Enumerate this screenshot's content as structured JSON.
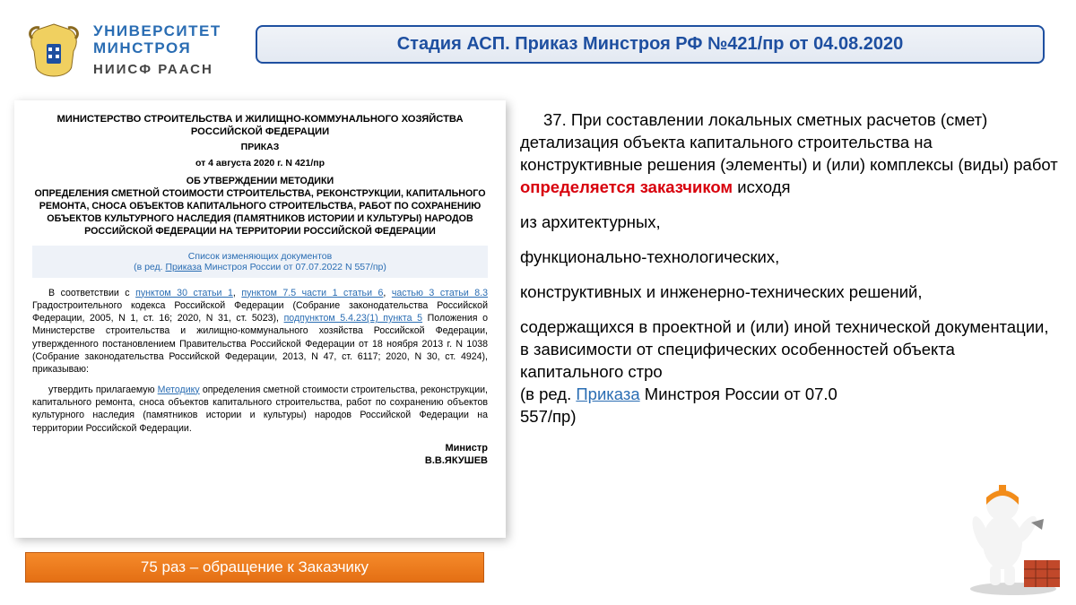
{
  "logo": {
    "uni1": "УНИВЕРСИТЕТ",
    "uni2": "МИНСТРОЯ",
    "sub": "НИИСФ РААСН"
  },
  "title": "Стадия АСП.  Приказ Минстроя РФ №421/пр от 04.08.2020",
  "doc": {
    "ministry": "МИНИСТЕРСТВО СТРОИТЕЛЬСТВА И ЖИЛИЩНО-КОММУНАЛЬНОГО ХОЗЯЙСТВА РОССИЙСКОЙ ФЕДЕРАЦИИ",
    "order": "ПРИКАЗ",
    "date": "от 4 августа 2020 г. N 421/пр",
    "about1": "ОБ УТВЕРЖДЕНИИ МЕТОДИКИ",
    "about2": "ОПРЕДЕЛЕНИЯ СМЕТНОЙ СТОИМОСТИ СТРОИТЕЛЬСТВА, РЕКОНСТРУКЦИИ, КАПИТАЛЬНОГО РЕМОНТА, СНОСА ОБЪЕКТОВ КАПИТАЛЬНОГО СТРОИТЕЛЬСТВА, РАБОТ ПО СОХРАНЕНИЮ ОБЪЕКТОВ КУЛЬТУРНОГО НАСЛЕДИЯ (ПАМЯТНИКОВ ИСТОРИИ И КУЛЬТУРЫ) НАРОДОВ РОССИЙСКОЙ ФЕДЕРАЦИИ НА ТЕРРИТОРИИ РОССИЙСКОЙ ФЕДЕРАЦИИ",
    "changes_caption": "Список изменяющих документов",
    "changes_line_pre": "(в ред. ",
    "changes_link": "Приказа",
    "changes_line_post": " Минстроя России от 07.07.2022 N 557/пр)",
    "p1_a": "В соответствии с ",
    "p1_l1": "пунктом 30 статьи 1",
    "p1_b": ", ",
    "p1_l2": "пунктом 7.5 части 1 статьи 6",
    "p1_c": ", ",
    "p1_l3": "частью 3 статьи 8.3",
    "p1_d": " Градостроительного кодекса Российской Федерации (Собрание законодательства Российской Федерации, 2005, N 1, ст. 16; 2020, N 31, ст. 5023), ",
    "p1_l4": "подпунктом 5.4.23(1) пункта 5",
    "p1_e": " Положения о Министерстве строительства и жилищно-коммунального хозяйства Российской Федерации, утвержденного постановлением Правительства Российской Федерации от 18 ноября 2013 г. N 1038 (Собрание законодательства Российской Федерации, 2013, N 47, ст. 6117; 2020, N 30, ст. 4924), приказываю:",
    "p2_a": "утвердить прилагаемую ",
    "p2_l": "Методику",
    "p2_b": " определения сметной стоимости строительства, реконструкции, капитального ремонта, сноса объектов капитального строительства, работ по сохранению объектов культурного наследия (памятников истории и культуры) народов Российской Федерации на территории Российской Федерации.",
    "sig_role": "Министр",
    "sig_name": "В.В.ЯКУШЕВ"
  },
  "orange": "75 раз – обращение к Заказчику",
  "right": {
    "p1_pre": "37. При составлении локальных сметных расчетов (смет) детализация объекта капитального строительства на конструктивные решения (элементы) и (или) комплексы (виды) работ ",
    "p1_red": "определяется заказчиком",
    "p1_post": " исходя",
    "p2": "из архитектурных,",
    "p3": "функционально-технологических,",
    "p4": "конструктивных и инженерно-технических решений,",
    "p5_a": "содержащихся в проектной и (или) иной технической документации, в зависимости от специфических особенностей объекта капитального стро",
    "p5_b": "(в ред. ",
    "p5_link": "Приказа",
    "p5_c": " Минстроя России от 07.0",
    "p5_d": "557/пр)"
  }
}
